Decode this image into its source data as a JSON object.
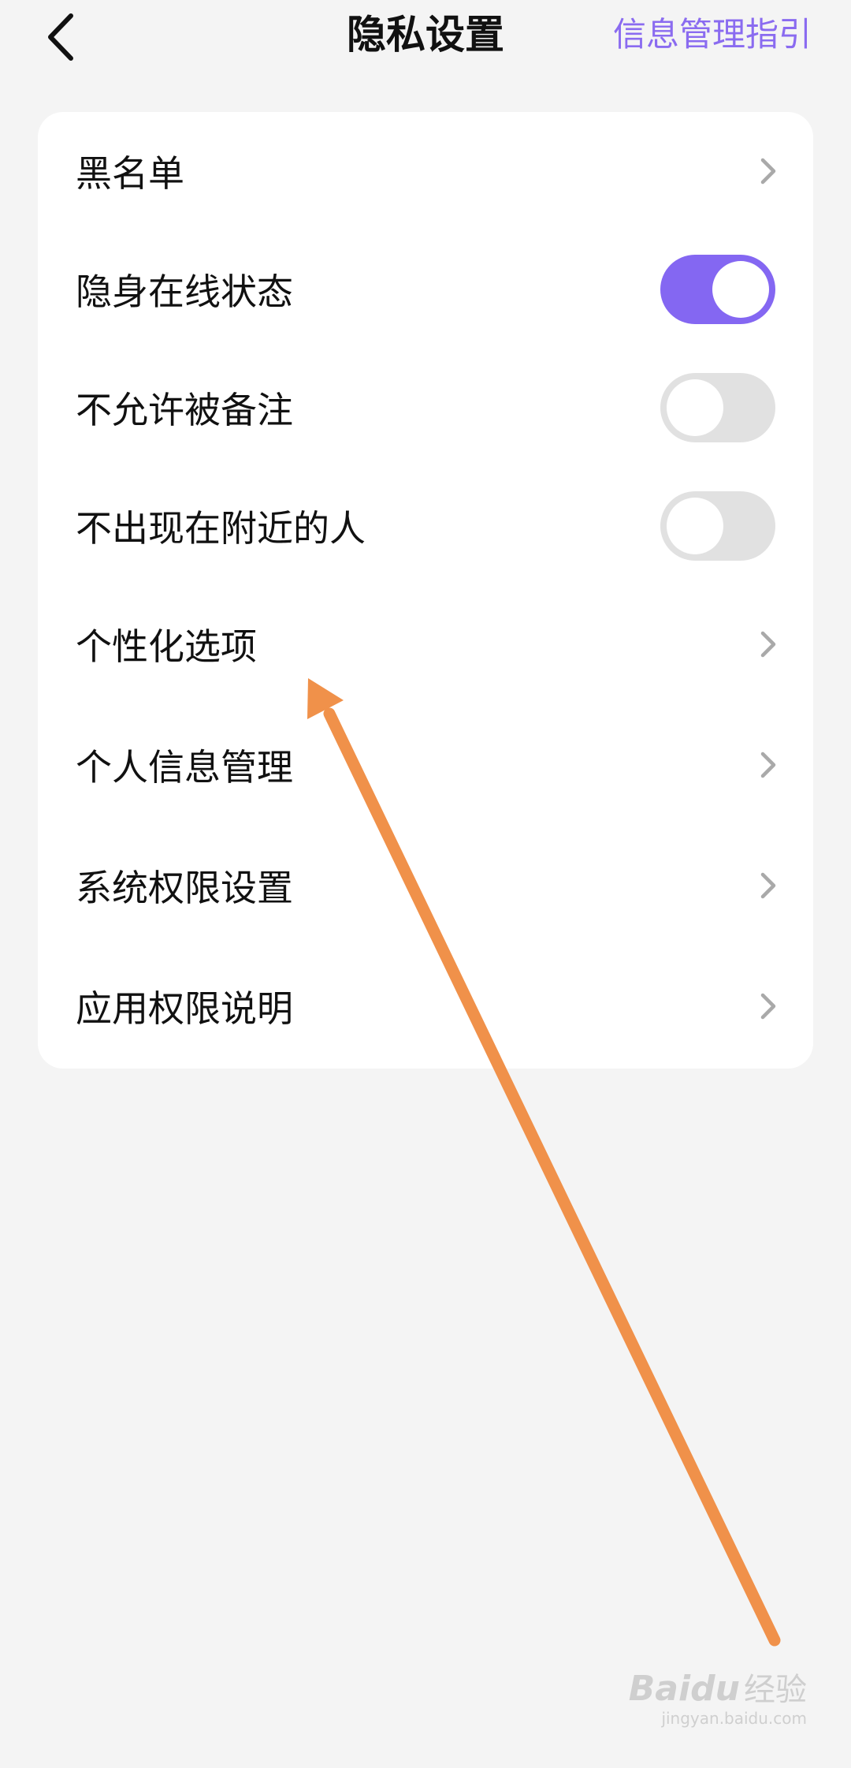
{
  "header": {
    "title": "隐私设置",
    "guide_link": "信息管理指引",
    "back_icon": "chevron-left-icon"
  },
  "settings": [
    {
      "label": "黑名单",
      "type": "link"
    },
    {
      "label": "隐身在线状态",
      "type": "toggle",
      "on": true
    },
    {
      "label": "不允许被备注",
      "type": "toggle",
      "on": false
    },
    {
      "label": "不出现在附近的人",
      "type": "toggle",
      "on": false
    },
    {
      "label": "个性化选项",
      "type": "link"
    },
    {
      "label": "个人信息管理",
      "type": "link"
    },
    {
      "label": "系统权限设置",
      "type": "link"
    },
    {
      "label": "应用权限说明",
      "type": "link"
    }
  ],
  "colors": {
    "accent": "#8467f2",
    "link": "#8a6bf0",
    "annotation_arrow": "#f0914a",
    "background": "#f4f4f4"
  },
  "watermark": {
    "brand": "Baidu",
    "sub": "经验",
    "url": "jingyan.baidu.com"
  }
}
